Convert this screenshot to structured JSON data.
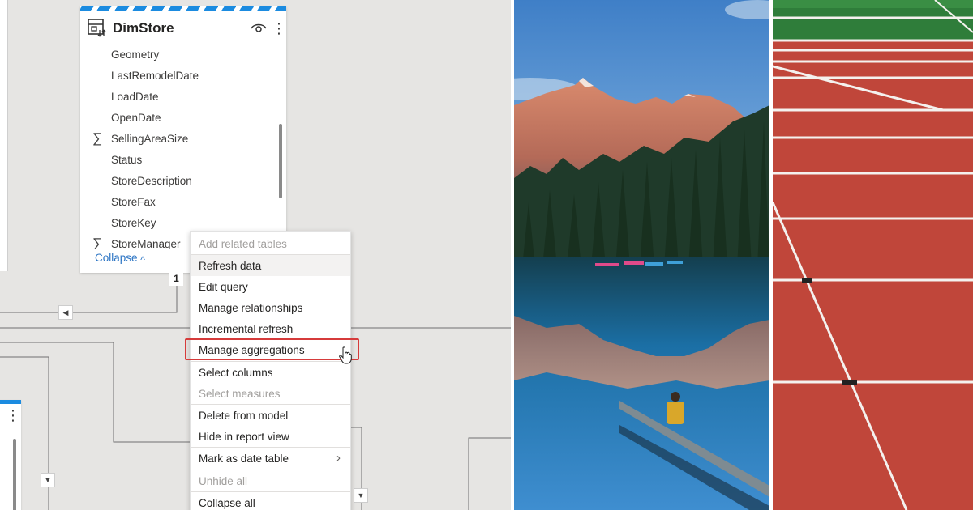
{
  "table_card": {
    "title": "DimStore",
    "fields": [
      {
        "label": "Geometry",
        "sigma": false
      },
      {
        "label": "LastRemodelDate",
        "sigma": false
      },
      {
        "label": "LoadDate",
        "sigma": false
      },
      {
        "label": "OpenDate",
        "sigma": false
      },
      {
        "label": "SellingAreaSize",
        "sigma": true
      },
      {
        "label": "Status",
        "sigma": false
      },
      {
        "label": "StoreDescription",
        "sigma": false
      },
      {
        "label": "StoreFax",
        "sigma": false
      },
      {
        "label": "StoreKey",
        "sigma": false
      },
      {
        "label": "StoreManager",
        "sigma": true
      }
    ],
    "sigma_symbol": "∑",
    "collapse_label": "Collapse",
    "collapse_chevron": "^",
    "relationship_cardinality": "1"
  },
  "context_menu": {
    "items": [
      {
        "label": "Add related tables",
        "disabled": true
      },
      {
        "label": "Refresh data",
        "hover": true
      },
      {
        "label": "Edit query"
      },
      {
        "label": "Manage relationships"
      },
      {
        "label": "Incremental refresh"
      },
      {
        "label": "Manage aggregations",
        "highlighted": true
      },
      {
        "label": "Select columns"
      },
      {
        "label": "Select measures",
        "disabled": true
      },
      {
        "label": "Delete from model"
      },
      {
        "label": "Hide in report view"
      },
      {
        "label": "Mark as date table",
        "submenu": true
      },
      {
        "label": "Unhide all",
        "disabled": true
      },
      {
        "label": "Collapse all"
      }
    ],
    "submenu_chevron": "›"
  },
  "colors": {
    "canvas_bg": "#e6e5e3",
    "table_header_accent": "#1b8be0",
    "link_blue": "#2b74c4",
    "highlight_border": "#d63b3b",
    "track_red": "#c0463a",
    "lake_blue": "#1b6fa5"
  },
  "icons": {
    "table_icon": "table-refresh-icon",
    "visibility_icon": "eye-icon",
    "more_icon": "more-vertical-icon",
    "pointer": "hand-cursor-icon"
  },
  "photos": [
    {
      "subject": "mountain-lake"
    },
    {
      "subject": "running-track"
    }
  ]
}
